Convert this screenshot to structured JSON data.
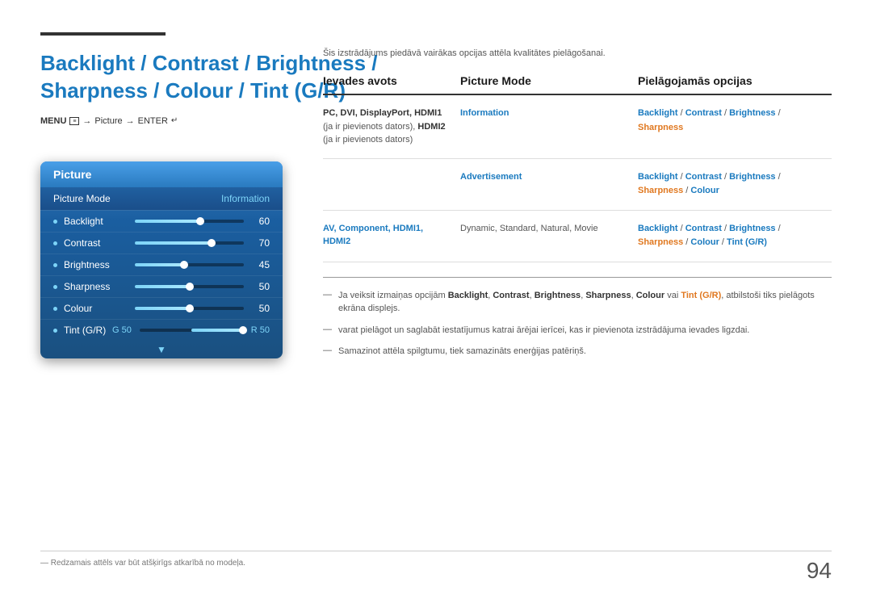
{
  "page": {
    "page_number": "94",
    "top_line_label": "decorative-line",
    "main_title_line1": "Backlight / Contrast / Brightness /",
    "main_title_line2": "Sharpness / Colour / Tint (G/R)",
    "menu_path": "MENU",
    "menu_arrow1": "→",
    "menu_picture": "Picture",
    "menu_arrow2": "→",
    "menu_enter": "ENTER",
    "intro_text": "Šis izstrādājums piedāvā vairākas opcijas attēla kvalitātes pielāgošanai."
  },
  "picture_panel": {
    "header": "Picture",
    "mode_label": "Picture Mode",
    "mode_value": "Information",
    "sliders": [
      {
        "label": "Backlight",
        "value": 60,
        "percent": 60
      },
      {
        "label": "Contrast",
        "value": 70,
        "percent": 70
      },
      {
        "label": "Brightness",
        "value": 45,
        "percent": 45
      },
      {
        "label": "Sharpness",
        "value": 50,
        "percent": 50
      },
      {
        "label": "Colour",
        "value": 50,
        "percent": 50
      }
    ],
    "tint_label": "Tint (G/R)",
    "tint_g_label": "G 50",
    "tint_r_label": "R 50"
  },
  "table": {
    "col1_header": "Ievades avots",
    "col2_header": "Picture Mode",
    "col3_header": "Pielāgojamās opcijas",
    "rows": [
      {
        "source": "PC, DVI, DisplayPort, HDMI1 (ja ir pievienots dators), HDMI2 (ja ir pievienots dators)",
        "source_highlights": [
          "PC",
          "DVI",
          "DisplayPort",
          "HDMI1",
          "HDMI2"
        ],
        "mode": "Information",
        "mode_color": "blue",
        "options_line1": "Backlight / Contrast / Brightness /",
        "options_line2": "Sharpness"
      },
      {
        "source": "",
        "mode": "Advertisement",
        "mode_color": "blue",
        "options_line1": "Backlight / Contrast / Brightness /",
        "options_line2": "Sharpness / Colour"
      },
      {
        "source": "AV, Component, HDMI1, HDMI2",
        "source_color": "blue",
        "mode": "Dynamic, Standard, Natural, Movie",
        "mode_color": "normal",
        "options_line1": "Backlight / Contrast / Brightness /",
        "options_line2": "Sharpness / Colour / Tint (G/R)"
      }
    ]
  },
  "notes": [
    {
      "text": "Ja veiksit izmaiņas opcijām Backlight, Contrast, Brightness, Sharpness, Colour vai Tint (G/R), atbilstoši tiks pielāgots ekrāna displejs.",
      "bold_words": [
        "Backlight",
        "Contrast",
        "Brightness",
        "Sharpness",
        "Colour",
        "Tint (G/R)"
      ]
    },
    {
      "text": "varat pielāgot un saglabāt iestatījumus katrai ārējai ierīcei, kas ir pievienota izstrādājuma ievades ligzdai."
    },
    {
      "text": "Samazinot attēla spilgtumu, tiek samazināts enerģijas patēriņš."
    }
  ],
  "bottom_note": "Redzamais attēls var būt atšķirīgs atkarībā no modeļa."
}
